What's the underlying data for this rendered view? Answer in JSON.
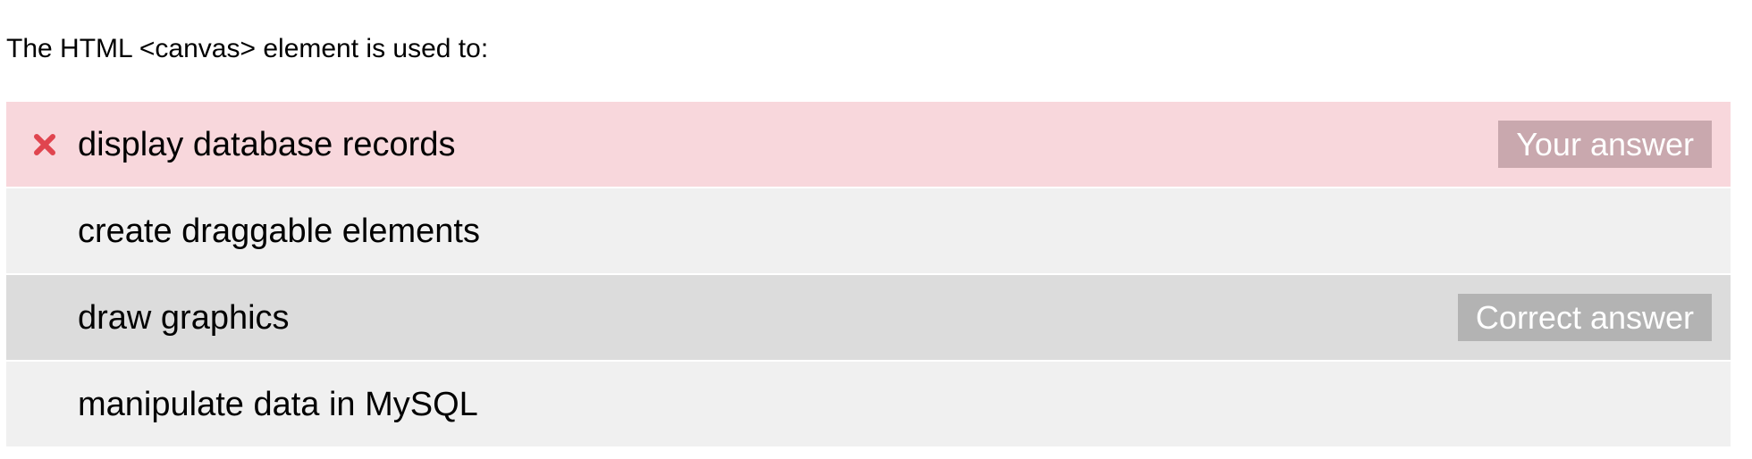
{
  "question": {
    "text": "The HTML <canvas> element is used to:"
  },
  "options": [
    {
      "text": "display database records",
      "state": "your-answer",
      "badge": "Your answer",
      "icon": "wrong-answer-x-icon"
    },
    {
      "text": "create draggable elements",
      "state": "neutral"
    },
    {
      "text": "draw graphics",
      "state": "correct-answer",
      "badge": "Correct answer"
    },
    {
      "text": "manipulate data in MySQL",
      "state": "neutral"
    }
  ],
  "colors": {
    "wrong_row_background": "#f8d7dc",
    "neutral_row_background": "#f0f0f0",
    "correct_row_background": "#dcdcdc",
    "wrong_icon": "#e0454f",
    "your_answer_badge": "#c9a8ae",
    "correct_answer_badge": "#b3b3b3",
    "badge_text": "#ffffff"
  }
}
